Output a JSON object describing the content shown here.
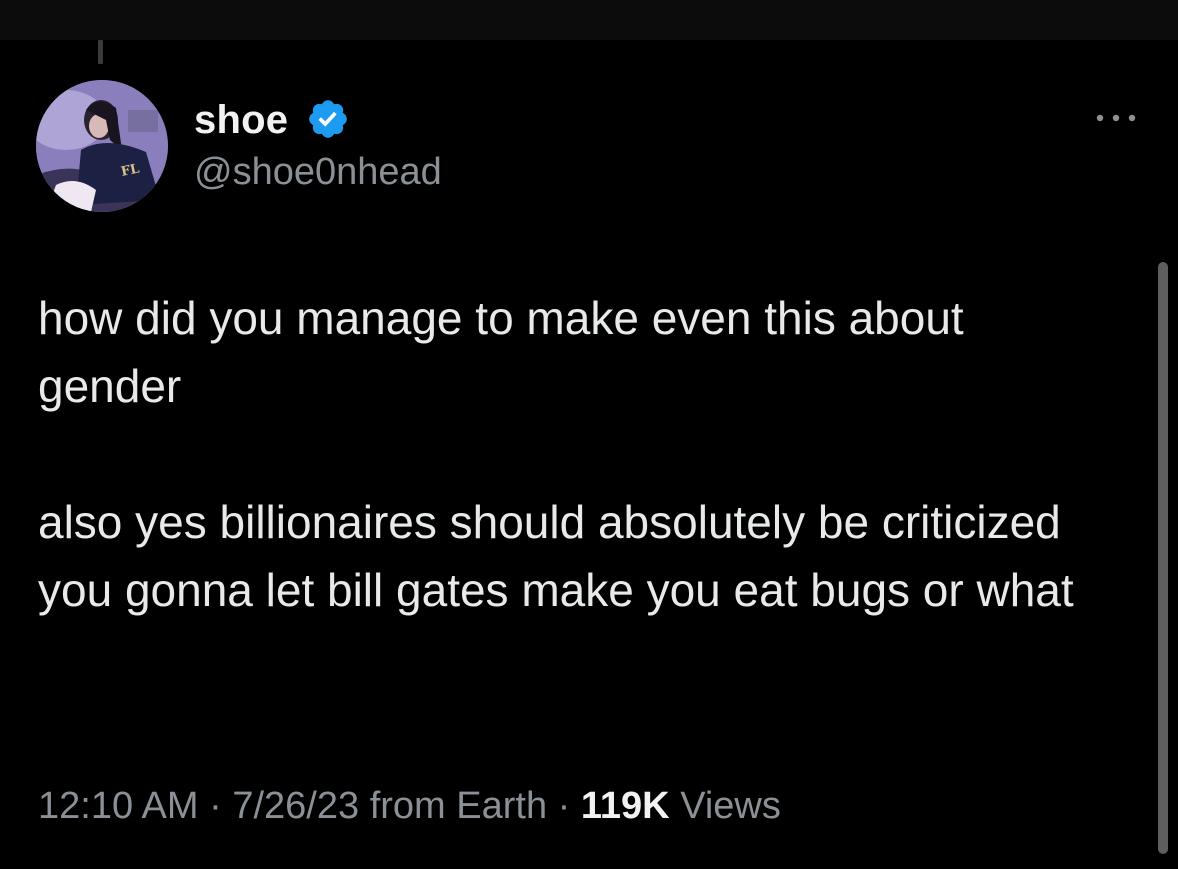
{
  "author": {
    "display_name": "shoe",
    "handle": "@shoe0nhead",
    "verified": true,
    "avatar_icon": "profile-photo",
    "avatar_jacket_text": "FL"
  },
  "tweet": {
    "paragraphs": [
      "how did you manage to make even this about gender",
      "also yes billionaires should absolutely be criticized you gonna let bill gates make you eat bugs or what"
    ]
  },
  "meta": {
    "time": "12:10 AM",
    "separator": " · ",
    "date": "7/26/23",
    "source": "from Earth",
    "views_count": "119K",
    "views_label": "Views"
  },
  "icons": {
    "verified": "verified-badge-icon",
    "more": "more-options-icon"
  },
  "colors": {
    "background": "#000000",
    "text_primary": "#e7e9ea",
    "text_secondary": "#8b9096",
    "verified": "#1d9bf0"
  }
}
